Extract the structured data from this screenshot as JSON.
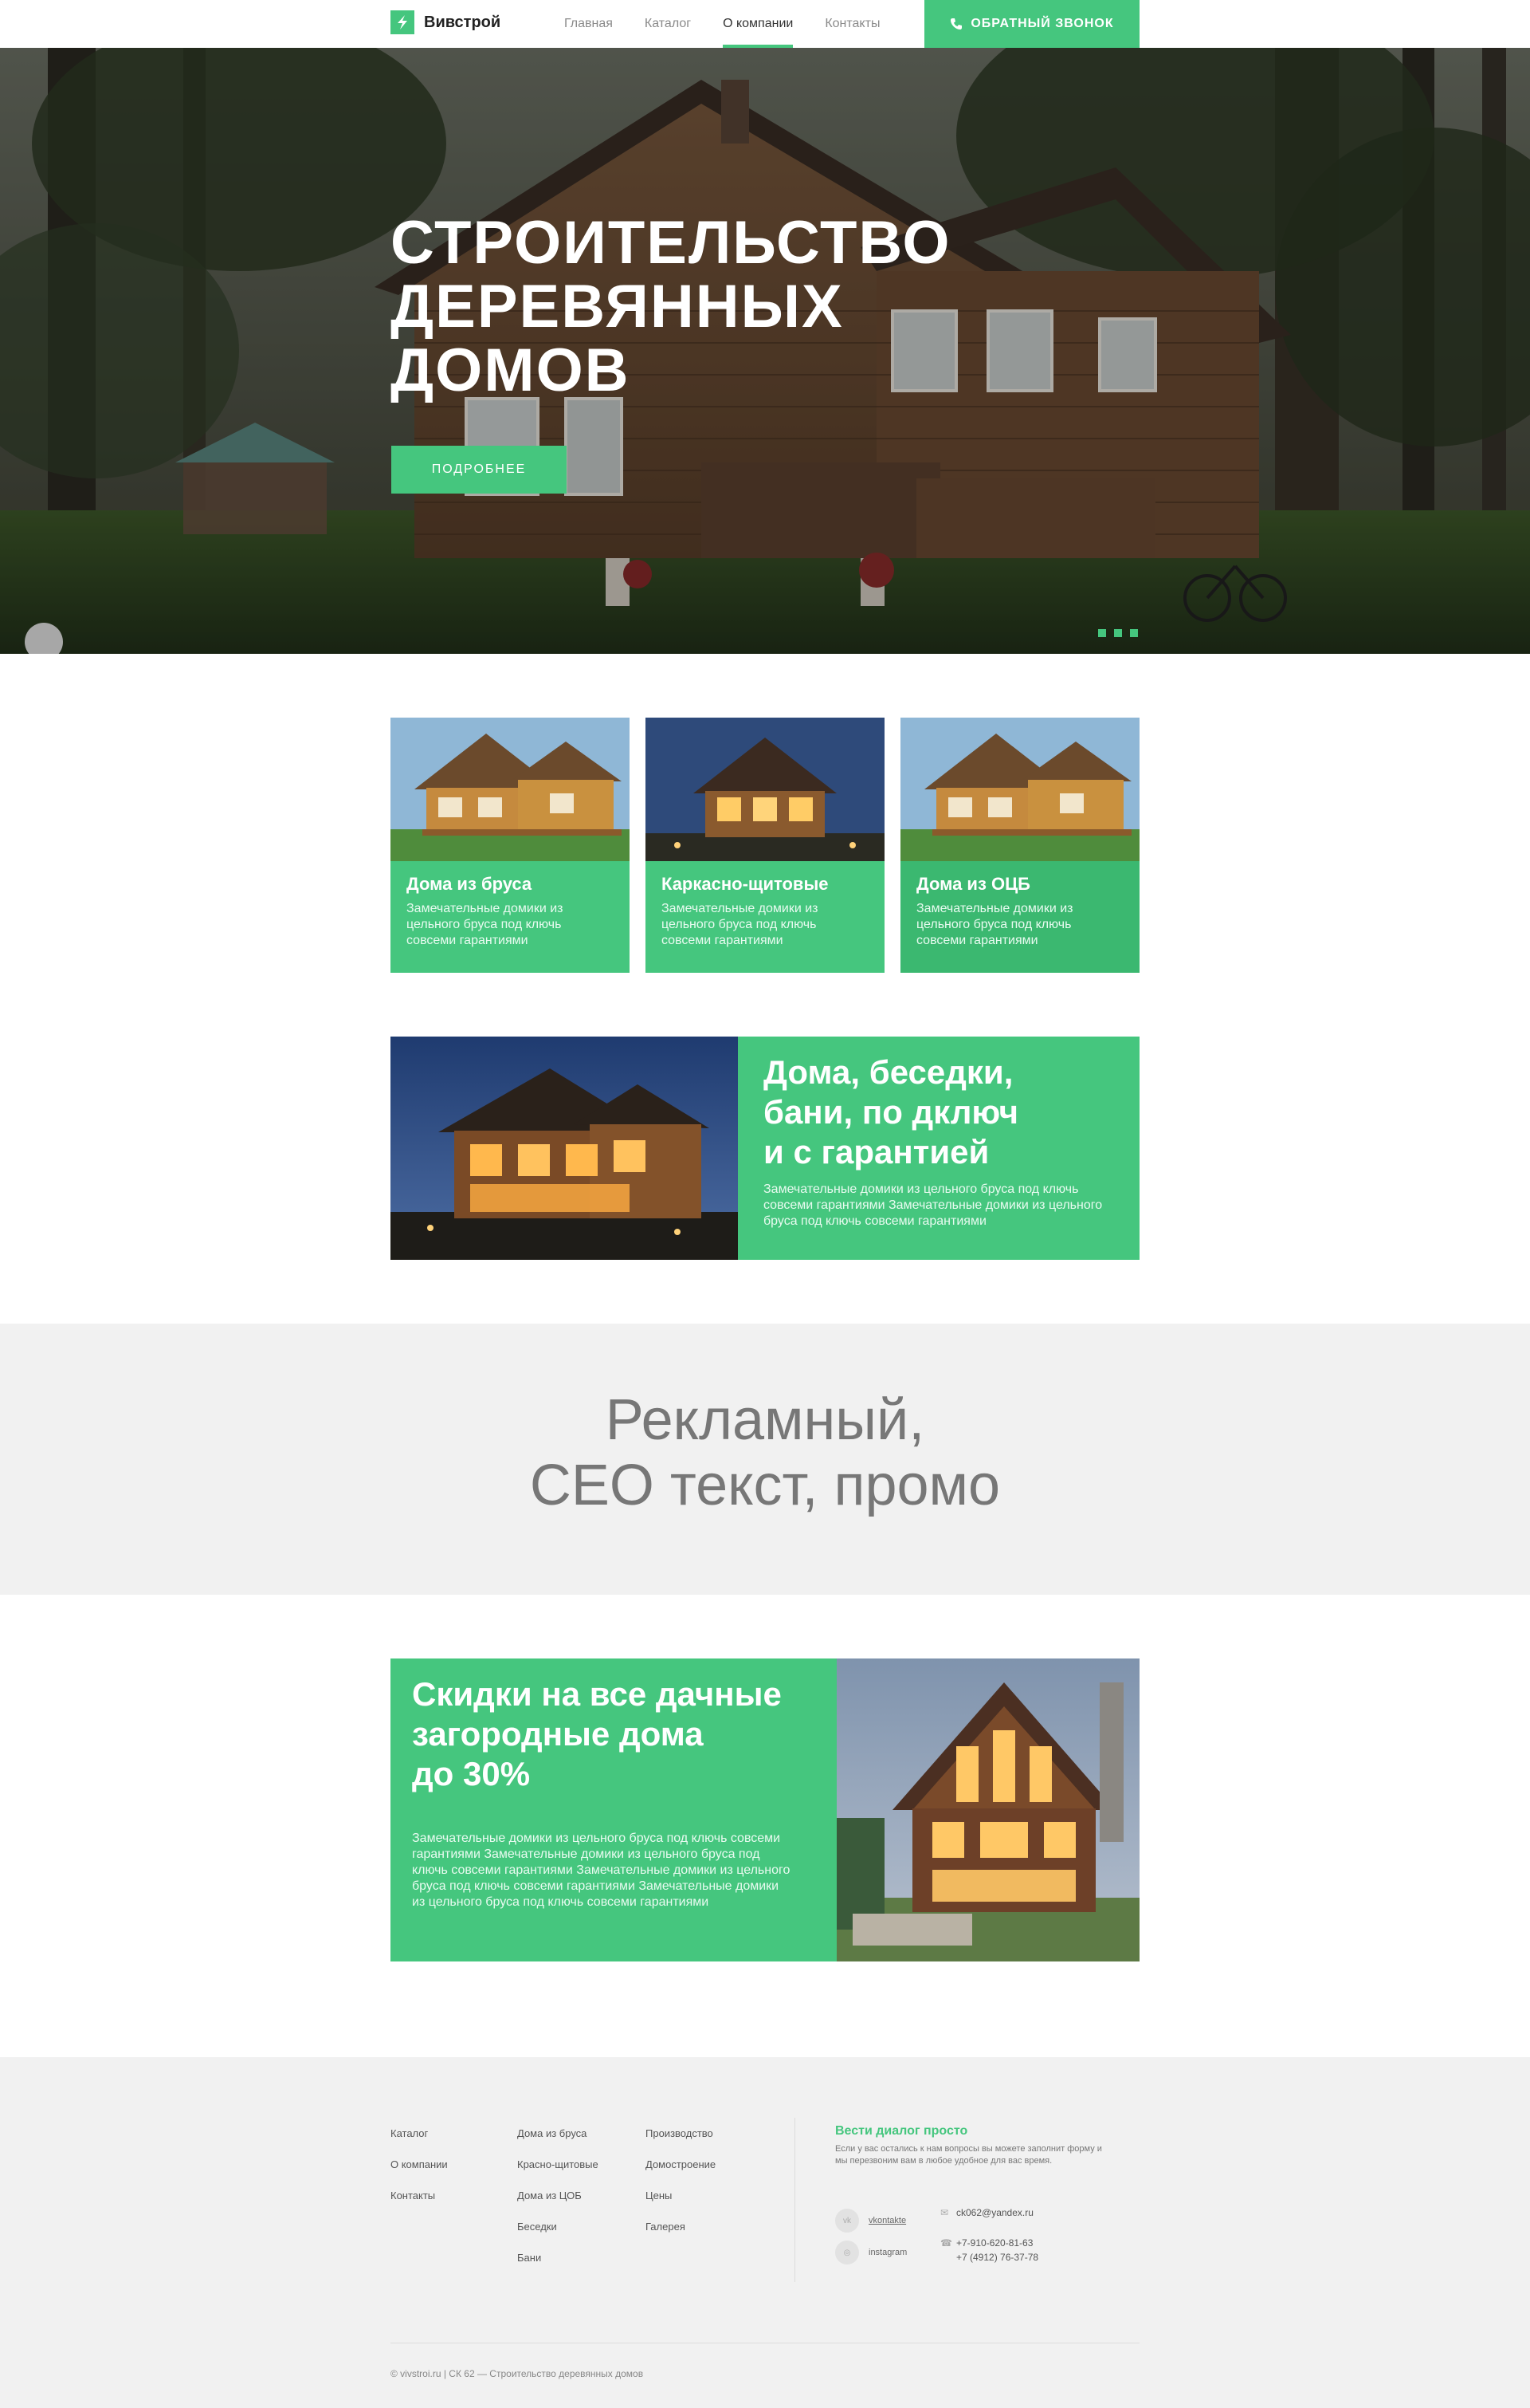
{
  "header": {
    "logo_text": "Вивстрой",
    "nav": [
      {
        "label": "Главная"
      },
      {
        "label": "Каталог"
      },
      {
        "label": "О компании"
      },
      {
        "label": "Контакты"
      }
    ],
    "callback_label": "ОБРАТНЫЙ ЗВОНОК"
  },
  "hero": {
    "title_lines": [
      "СТРОИТЕЛЬСТВО",
      "ДЕРЕВЯННЫХ",
      "ДОМОВ"
    ],
    "button_label": "ПОДРОБНЕЕ",
    "slides_count": 3
  },
  "cards": [
    {
      "title": "Дома из бруса",
      "desc": "Замечательные домики из цельного бруса под ключь совсеми гарантиями"
    },
    {
      "title": "Каркасно-щитовые",
      "desc": "Замечательные домики из цельного бруса под ключь совсеми гарантиями"
    },
    {
      "title": "Дома из ОЦБ",
      "desc": "Замечательные домики из цельного бруса под ключь совсеми гарантиями"
    }
  ],
  "promo": {
    "title_lines": [
      "Дома, беседки,",
      "бани, по дключ",
      "и с гарантией"
    ],
    "desc": "Замечательные домики из цельного бруса под ключь совсеми гарантиями Замечательные домики из цельного бруса под ключь совсеми гарантиями"
  },
  "seo": {
    "lines": [
      "Рекламный,",
      "СЕО текст, промо"
    ]
  },
  "sale": {
    "title_lines": [
      "Скидки на все дачные",
      "загородные дома",
      "до 30%"
    ],
    "desc": "Замечательные домики из цельного бруса под ключь совсеми гарантиями Замечательные домики из цельного бруса под ключь совсеми гарантиями Замечательные домики из цельного бруса под ключь совсеми гарантиями Замечательные домики из цельного бруса под ключь совсеми гарантиями"
  },
  "footer": {
    "col1": [
      "Каталог",
      "О компании",
      "Контакты"
    ],
    "col2": [
      "Дома из бруса",
      "Красно-щитовые",
      "Дома из ЦОБ",
      "Беседки",
      "Бани"
    ],
    "col3": [
      "Производство",
      "Домостроение",
      "Цены",
      "Галерея"
    ],
    "contact_title": "Вести диалог просто",
    "contact_desc": "Если у вас остались к нам вопросы вы можете заполнит форму и мы перезвоним вам в любое удобное для вас время.",
    "social": [
      {
        "icon": "vk-icon",
        "label": "vkontakte"
      },
      {
        "icon": "instagram-icon",
        "label": "instagram"
      }
    ],
    "email": "ck062@yandex.ru",
    "phones": [
      "+7-910-620-81-63",
      "+7 (4912) 76-37-78"
    ],
    "copyright": "© vivstroi.ru | СК 62 — Строительство деревянных домов"
  },
  "colors": {
    "accent": "#45c67e",
    "light_bg": "#f1f1f1"
  }
}
